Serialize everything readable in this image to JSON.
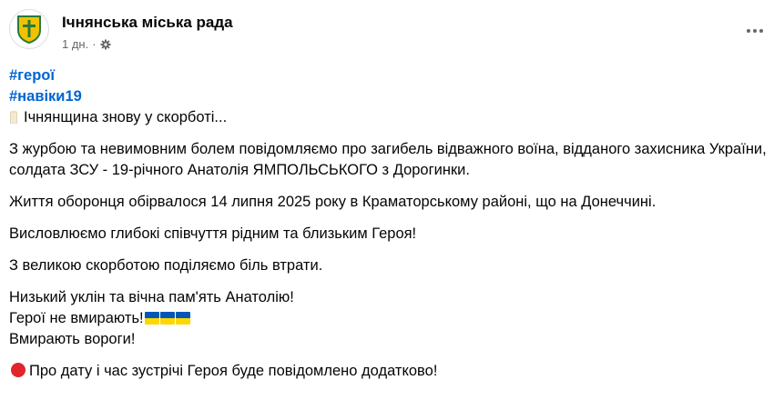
{
  "header": {
    "page_name": "Ічнянська міська рада",
    "timestamp": "1 дн.",
    "separator": "·",
    "audience_icon": "gear-icon",
    "more_icon": "ellipsis-icon"
  },
  "post": {
    "hashtags": [
      "#герої",
      "#навіки19"
    ],
    "intro": "Ічнянщина знову у скорботі...",
    "paragraph_1": "З журбою та невимовним болем повідомляємо про загибель відважного воїна, відданого захисника України, солдата ЗСУ - 19-річного Анатолія ЯМПОЛЬСЬКОГО з Дорогинки.",
    "paragraph_2": "Життя оборонця обірвалося 14 липня 2025 року в Краматорському районі, що на Донеччині.",
    "paragraph_3": "Висловлюємо глибокі співчуття рідним та близьким Героя!",
    "paragraph_4": "З великою скорботою поділяємо біль втрати.",
    "closing_line_1": "Низький уклін та вічна пам'ять Анатолію!",
    "closing_line_2": "Герої не вмирають!",
    "closing_line_3": "Вмирають вороги!",
    "final_note": "Про дату і час зустрічі Героя буде повідомлено додатково!"
  },
  "colors": {
    "hashtag": "#0064d1",
    "meta_text": "#65676b",
    "flag_blue": "#0057b7",
    "flag_yellow": "#ffd700",
    "red_circle": "#e0252b"
  }
}
